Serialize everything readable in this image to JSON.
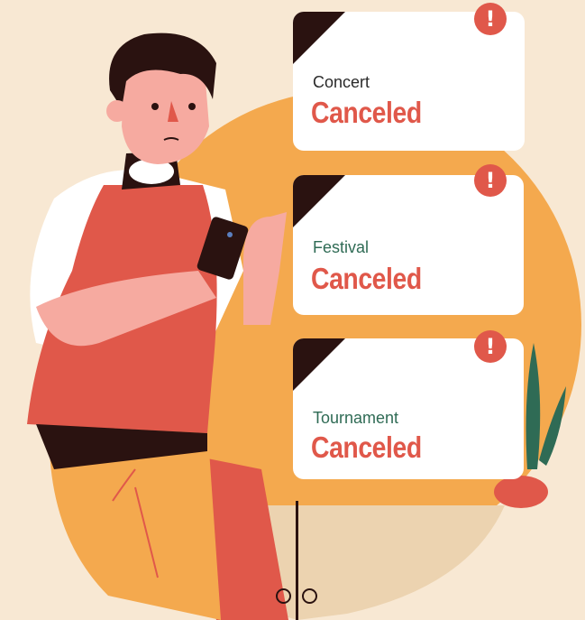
{
  "notifications": [
    {
      "event": "Concert",
      "status": "Canceled",
      "event_color": "#2a2a2a",
      "alert_icon": "exclamation-icon"
    },
    {
      "event": "Festival",
      "status": "Canceled",
      "event_color": "#2f6b55",
      "alert_icon": "exclamation-icon"
    },
    {
      "event": "Tournament",
      "status": "Canceled",
      "event_color": "#2f6b55",
      "alert_icon": "exclamation-icon"
    }
  ],
  "alert_glyph": "!",
  "colors": {
    "background": "#f8e8d3",
    "circle": "#f4a94e",
    "accent_red": "#e0584a",
    "dark": "#2a1210",
    "skin": "#f6aaa0"
  }
}
